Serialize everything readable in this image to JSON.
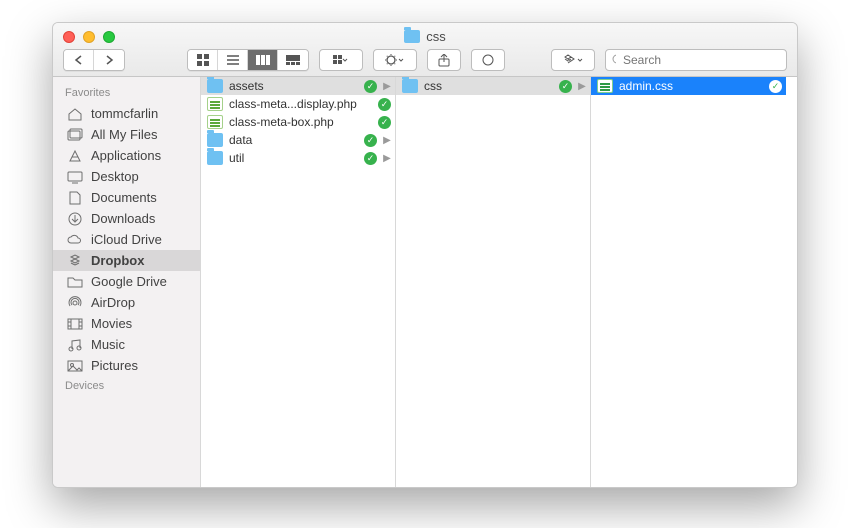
{
  "window": {
    "title": "css"
  },
  "toolbar": {
    "search_placeholder": "Search"
  },
  "sidebar": {
    "sections": [
      {
        "label": "Favorites",
        "items": [
          {
            "label": "tommcfarlin",
            "icon": "home"
          },
          {
            "label": "All My Files",
            "icon": "all-files"
          },
          {
            "label": "Applications",
            "icon": "applications"
          },
          {
            "label": "Desktop",
            "icon": "desktop"
          },
          {
            "label": "Documents",
            "icon": "documents"
          },
          {
            "label": "Downloads",
            "icon": "downloads"
          },
          {
            "label": "iCloud Drive",
            "icon": "cloud"
          },
          {
            "label": "Dropbox",
            "icon": "dropbox",
            "active": true
          },
          {
            "label": "Google Drive",
            "icon": "folder"
          },
          {
            "label": "AirDrop",
            "icon": "airdrop"
          },
          {
            "label": "Movies",
            "icon": "movies"
          },
          {
            "label": "Music",
            "icon": "music"
          },
          {
            "label": "Pictures",
            "icon": "pictures"
          }
        ]
      },
      {
        "label": "Devices",
        "items": []
      }
    ]
  },
  "columns": [
    {
      "items": [
        {
          "name": "assets",
          "type": "folder",
          "synced": true,
          "expandable": true,
          "selected": true
        },
        {
          "name": "class-meta...display.php",
          "type": "php",
          "synced": true
        },
        {
          "name": "class-meta-box.php",
          "type": "php",
          "synced": true
        },
        {
          "name": "data",
          "type": "folder",
          "synced": true,
          "expandable": true
        },
        {
          "name": "util",
          "type": "folder",
          "synced": true,
          "expandable": true
        }
      ]
    },
    {
      "items": [
        {
          "name": "css",
          "type": "folder",
          "synced": true,
          "expandable": true,
          "selected": true
        }
      ]
    },
    {
      "items": [
        {
          "name": "admin.css",
          "type": "css",
          "synced": true,
          "selected_blue": true
        }
      ]
    }
  ]
}
